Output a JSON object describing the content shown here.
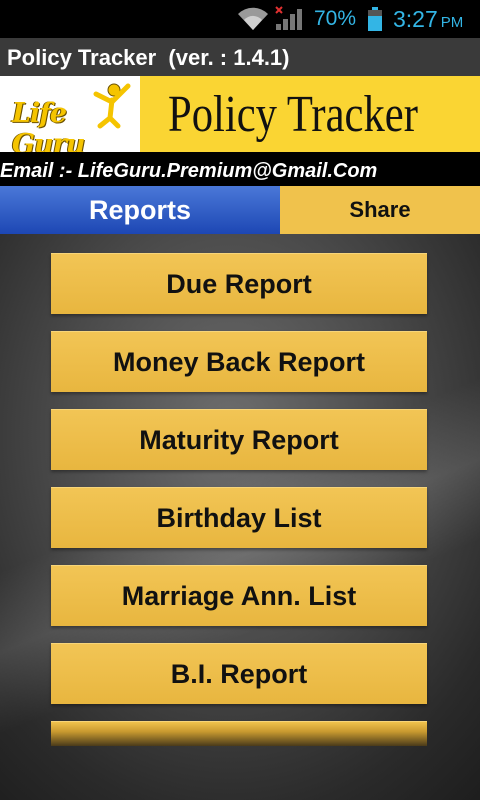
{
  "status_bar": {
    "battery_percent": "70%",
    "time": "3:27",
    "ampm": "PM",
    "icons": [
      "wifi-icon",
      "signal-icon",
      "battery-icon"
    ],
    "accent_color": "#33b5e5"
  },
  "title_bar": {
    "title": "Policy Tracker  (ver. : 1.4.1)"
  },
  "banner": {
    "logo_text": "Life Guru",
    "product_title": "Policy Tracker",
    "brand_color": "#fad533"
  },
  "email_line": {
    "text": "Email :- LifeGuru.Premium@Gmail.Com"
  },
  "tabs": [
    {
      "label": "Reports",
      "active": true
    },
    {
      "label": "Share",
      "active": false
    }
  ],
  "menu": {
    "items": [
      {
        "label": "Due Report"
      },
      {
        "label": "Money Back Report"
      },
      {
        "label": "Maturity Report"
      },
      {
        "label": "Birthday List"
      },
      {
        "label": "Marriage Ann. List"
      },
      {
        "label": "B.I. Report"
      }
    ],
    "button_color": "#f0c24c"
  }
}
